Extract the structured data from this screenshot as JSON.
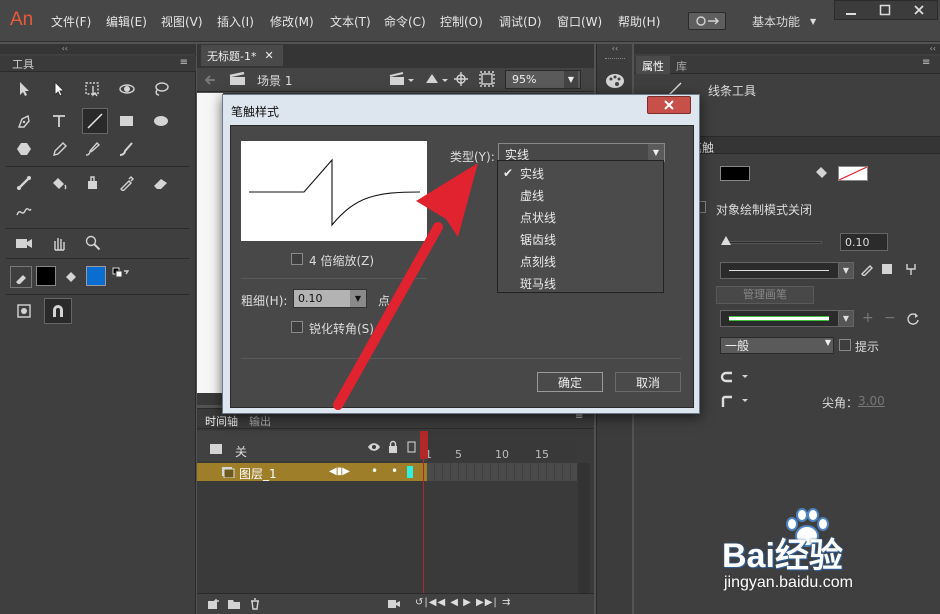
{
  "app": {
    "logo": "An"
  },
  "menu": [
    "文件(F)",
    "编辑(E)",
    "视图(V)",
    "插入(I)",
    "修改(M)",
    "文本(T)",
    "命令(C)",
    "控制(O)",
    "调试(D)",
    "窗口(W)",
    "帮助(H)"
  ],
  "workspace": {
    "label": "基本功能"
  },
  "tools_panel": {
    "title": "工具"
  },
  "document": {
    "tab": "无标题-1*",
    "scene": "场景 1",
    "zoom": "95%"
  },
  "properties": {
    "tabs": [
      "属性",
      "库"
    ],
    "tool_name": "线条工具",
    "section_fill_stroke": "笔触",
    "object_draw": "对象绘制模式关闭",
    "stroke_value": "0.10",
    "manage_brush": "管理画笔",
    "scale": "一般",
    "hint": "提示",
    "miter_label": "尖角：",
    "miter_value": "3.00"
  },
  "dialog": {
    "title": "笔触样式",
    "type_label": "类型(Y):",
    "type_value": "实线",
    "zoom_4x": "4 倍缩放(Z)",
    "thickness_label": "粗细(H):",
    "thickness_value": "0.10",
    "thickness_unit": "点",
    "sharpen": "锐化转角(S)",
    "ok": "确定",
    "cancel": "取消",
    "type_options": [
      "实线",
      "虚线",
      "点状线",
      "锯齿线",
      "点刻线",
      "斑马线"
    ],
    "selected_index": 0
  },
  "timeline": {
    "tabs": [
      "时间轴",
      "输出"
    ],
    "ruler": [
      "1",
      "5",
      "10",
      "15"
    ],
    "folder_label": "关",
    "layer_name": "图层_1"
  },
  "watermark": {
    "brand": "Bai经验",
    "url": "jingyan.baidu.com"
  },
  "colors": {
    "accent_red": "#e0232e",
    "layer_gold": "#9e7e28",
    "fill_blue": "#0a6ed1",
    "playhead": "#b0282a"
  }
}
